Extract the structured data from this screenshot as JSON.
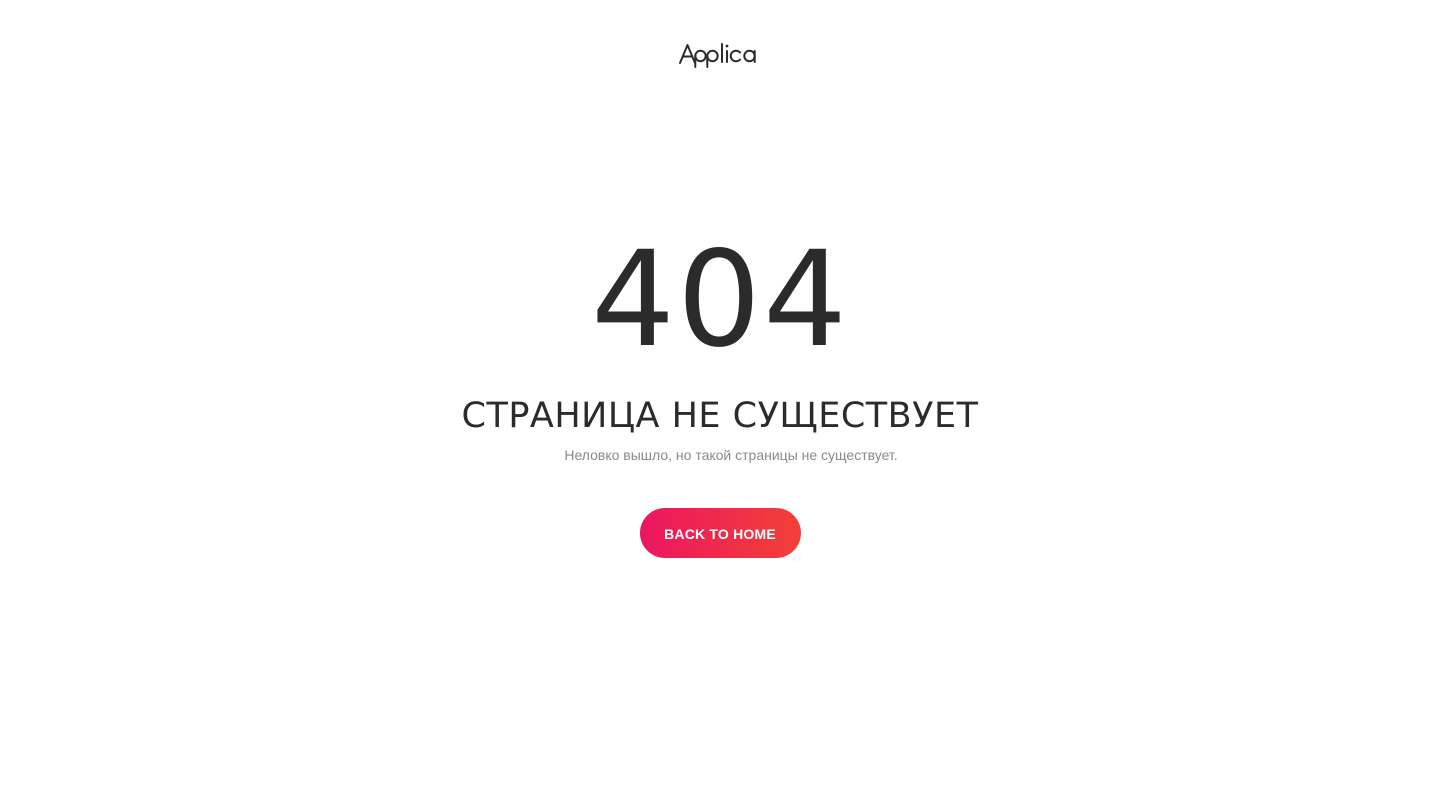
{
  "brand": {
    "logo_text": "Applica"
  },
  "error": {
    "code": "404",
    "title": "СТРАНИЦА НЕ СУЩЕСТВУЕТ",
    "message": "Неловко вышло, но такой страницы не существует."
  },
  "actions": {
    "back_home_label": "BACK TO HOME"
  },
  "colors": {
    "background": "#ffffff",
    "text_dark": "#2b2b2b",
    "text_muted": "#8a8a8a",
    "button_gradient_start": "#ec1561",
    "button_gradient_end": "#f24037",
    "button_text": "#ffffff"
  }
}
